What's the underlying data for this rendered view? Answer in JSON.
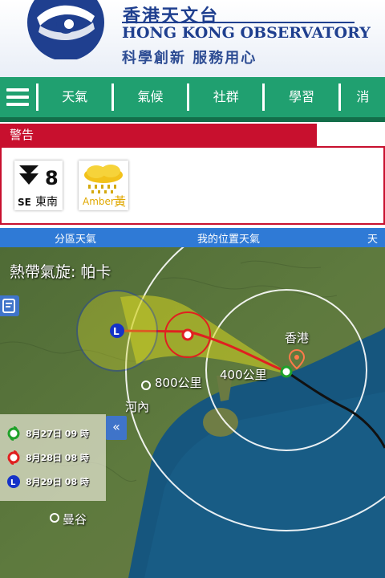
{
  "header": {
    "title_zh": "香港天文台",
    "title_en": "HONG KONG OBSERVATORY",
    "slogan": "科學創新 服務用心"
  },
  "nav": {
    "items": [
      {
        "label": "天氣"
      },
      {
        "label": "氣候"
      },
      {
        "label": "社群"
      },
      {
        "label": "學習"
      },
      {
        "label": "消"
      }
    ]
  },
  "warnings": {
    "heading": "警告",
    "signal8": {
      "number": "8",
      "code": "SE",
      "direction": "東南"
    },
    "rainstorm": {
      "label_en": "Amber",
      "label_zh": "黃"
    }
  },
  "subnav": {
    "items": [
      {
        "label": "分區天氣"
      },
      {
        "label": "我的位置天氣"
      },
      {
        "label": "天氣"
      }
    ]
  },
  "map": {
    "title": "熱帶氣旋: 帕卡",
    "labels": {
      "hongkong": "香港",
      "km400": "400公里",
      "km800": "800公里",
      "hanoi": "河內",
      "bangkok": "曼谷"
    },
    "legend": [
      {
        "label": "8月27日 09 時",
        "color": "#1fa12a"
      },
      {
        "label": "8月28日 08 時",
        "color": "#e02020"
      },
      {
        "label": "8月29日 08 時",
        "color": "#1533c8"
      }
    ],
    "collapse_glyph": "«"
  },
  "colors": {
    "brand": "#1f3f8f",
    "nav": "#20a070",
    "warning": "#c8102e",
    "subnav": "#2f7ad6"
  }
}
